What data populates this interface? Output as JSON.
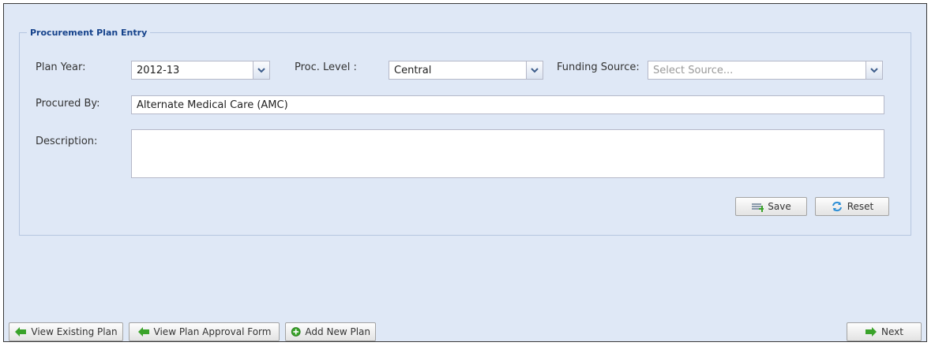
{
  "form": {
    "legend": "Procurement Plan Entry",
    "plan_year": {
      "label": "Plan Year:",
      "value": "2012-13"
    },
    "proc_level": {
      "label": "Proc. Level :",
      "value": "Central"
    },
    "funding_source": {
      "label": "Funding Source:",
      "placeholder": "Select Source..."
    },
    "procured_by": {
      "label": "Procured By:",
      "value": "Alternate Medical Care (AMC)"
    },
    "description": {
      "label": "Description:",
      "value": ""
    },
    "save_label": "Save",
    "reset_label": "Reset"
  },
  "footer": {
    "view_existing_label": "View Existing Plan",
    "view_approval_label": "View Plan Approval Form",
    "add_new_label": "Add New Plan",
    "next_label": "Next"
  },
  "colors": {
    "panel_bg": "#dfe8f6",
    "legend_text": "#15428b",
    "arrow_green": "#3aa32a"
  }
}
